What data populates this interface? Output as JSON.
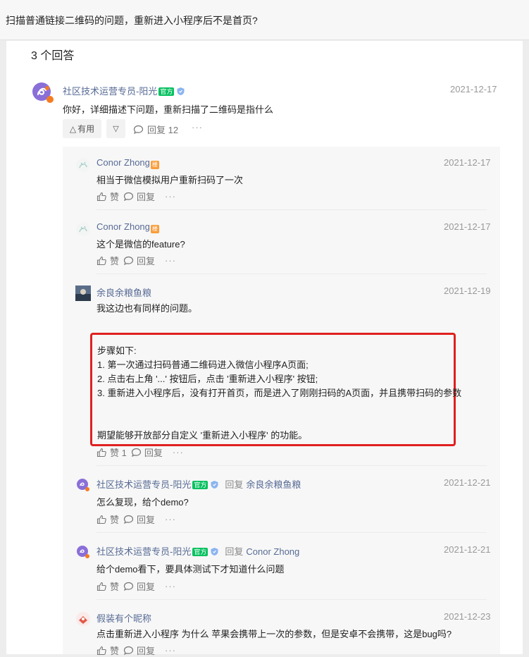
{
  "question": {
    "title": "扫描普通链接二维码的问题，重新进入小程序后不是首页?"
  },
  "answer_count": "3 个回答",
  "main_answer": {
    "author": "社区技术运营专员-阳光",
    "official_badge": "官方",
    "date": "2021-12-17",
    "text": "你好，详细描述下问题，重新扫描了二维码是指什么",
    "useful_label": "有用",
    "reply_label": "回复 12",
    "more": "···"
  },
  "comments": [
    {
      "author": "Conor Zhong",
      "author_badge": "楼",
      "date": "2021-12-17",
      "text": "相当于微信模拟用户重新扫码了一次",
      "like": "赞",
      "reply": "回复",
      "more": "···"
    },
    {
      "author": "Conor Zhong",
      "author_badge": "楼",
      "date": "2021-12-17",
      "text": "这个是微信的feature?",
      "like": "赞",
      "reply": "回复",
      "more": "···"
    },
    {
      "author": "余良余粮鱼粮",
      "date": "2021-12-19",
      "text": "我这边也有同样的问题。",
      "like": "赞 1",
      "reply": "回复",
      "more": "···",
      "detail": "步骤如下:\n1. 第一次通过扫码普通二维码进入微信小程序A页面;\n2. 点击右上角 '...' 按钮后，点击 '重新进入小程序' 按钮;\n3. 重新进入小程序后，没有打开首页，而是进入了刚刚扫码的A页面，并且携带扫码的参数\n\n\n期望能够开放部分自定义 '重新进入小程序' 的功能。"
    },
    {
      "author": "社区技术运营专员-阳光",
      "official_badge": "官方",
      "reply_word": "回复",
      "reply_to": "余良余粮鱼粮",
      "date": "2021-12-21",
      "text": "怎么复现，给个demo?",
      "like": "赞",
      "reply": "回复",
      "more": "···"
    },
    {
      "author": "社区技术运营专员-阳光",
      "official_badge": "官方",
      "reply_word": "回复",
      "reply_to": "Conor Zhong",
      "date": "2021-12-21",
      "text": "给个demo看下，要具体测试下才知道什么问题",
      "like": "赞",
      "reply": "回复",
      "more": "···"
    },
    {
      "author": "假装有个昵称",
      "date": "2021-12-23",
      "text": "点击重新进入小程序 为什么 苹果会携带上一次的参数，但是安卓不会携带，这是bug吗?",
      "like": "赞",
      "reply": "回复",
      "more": "···"
    }
  ],
  "colors": {
    "link": "#576b95",
    "official": "#07c160",
    "author_badge": "#fa9d3b",
    "highlight": "#e02020"
  }
}
